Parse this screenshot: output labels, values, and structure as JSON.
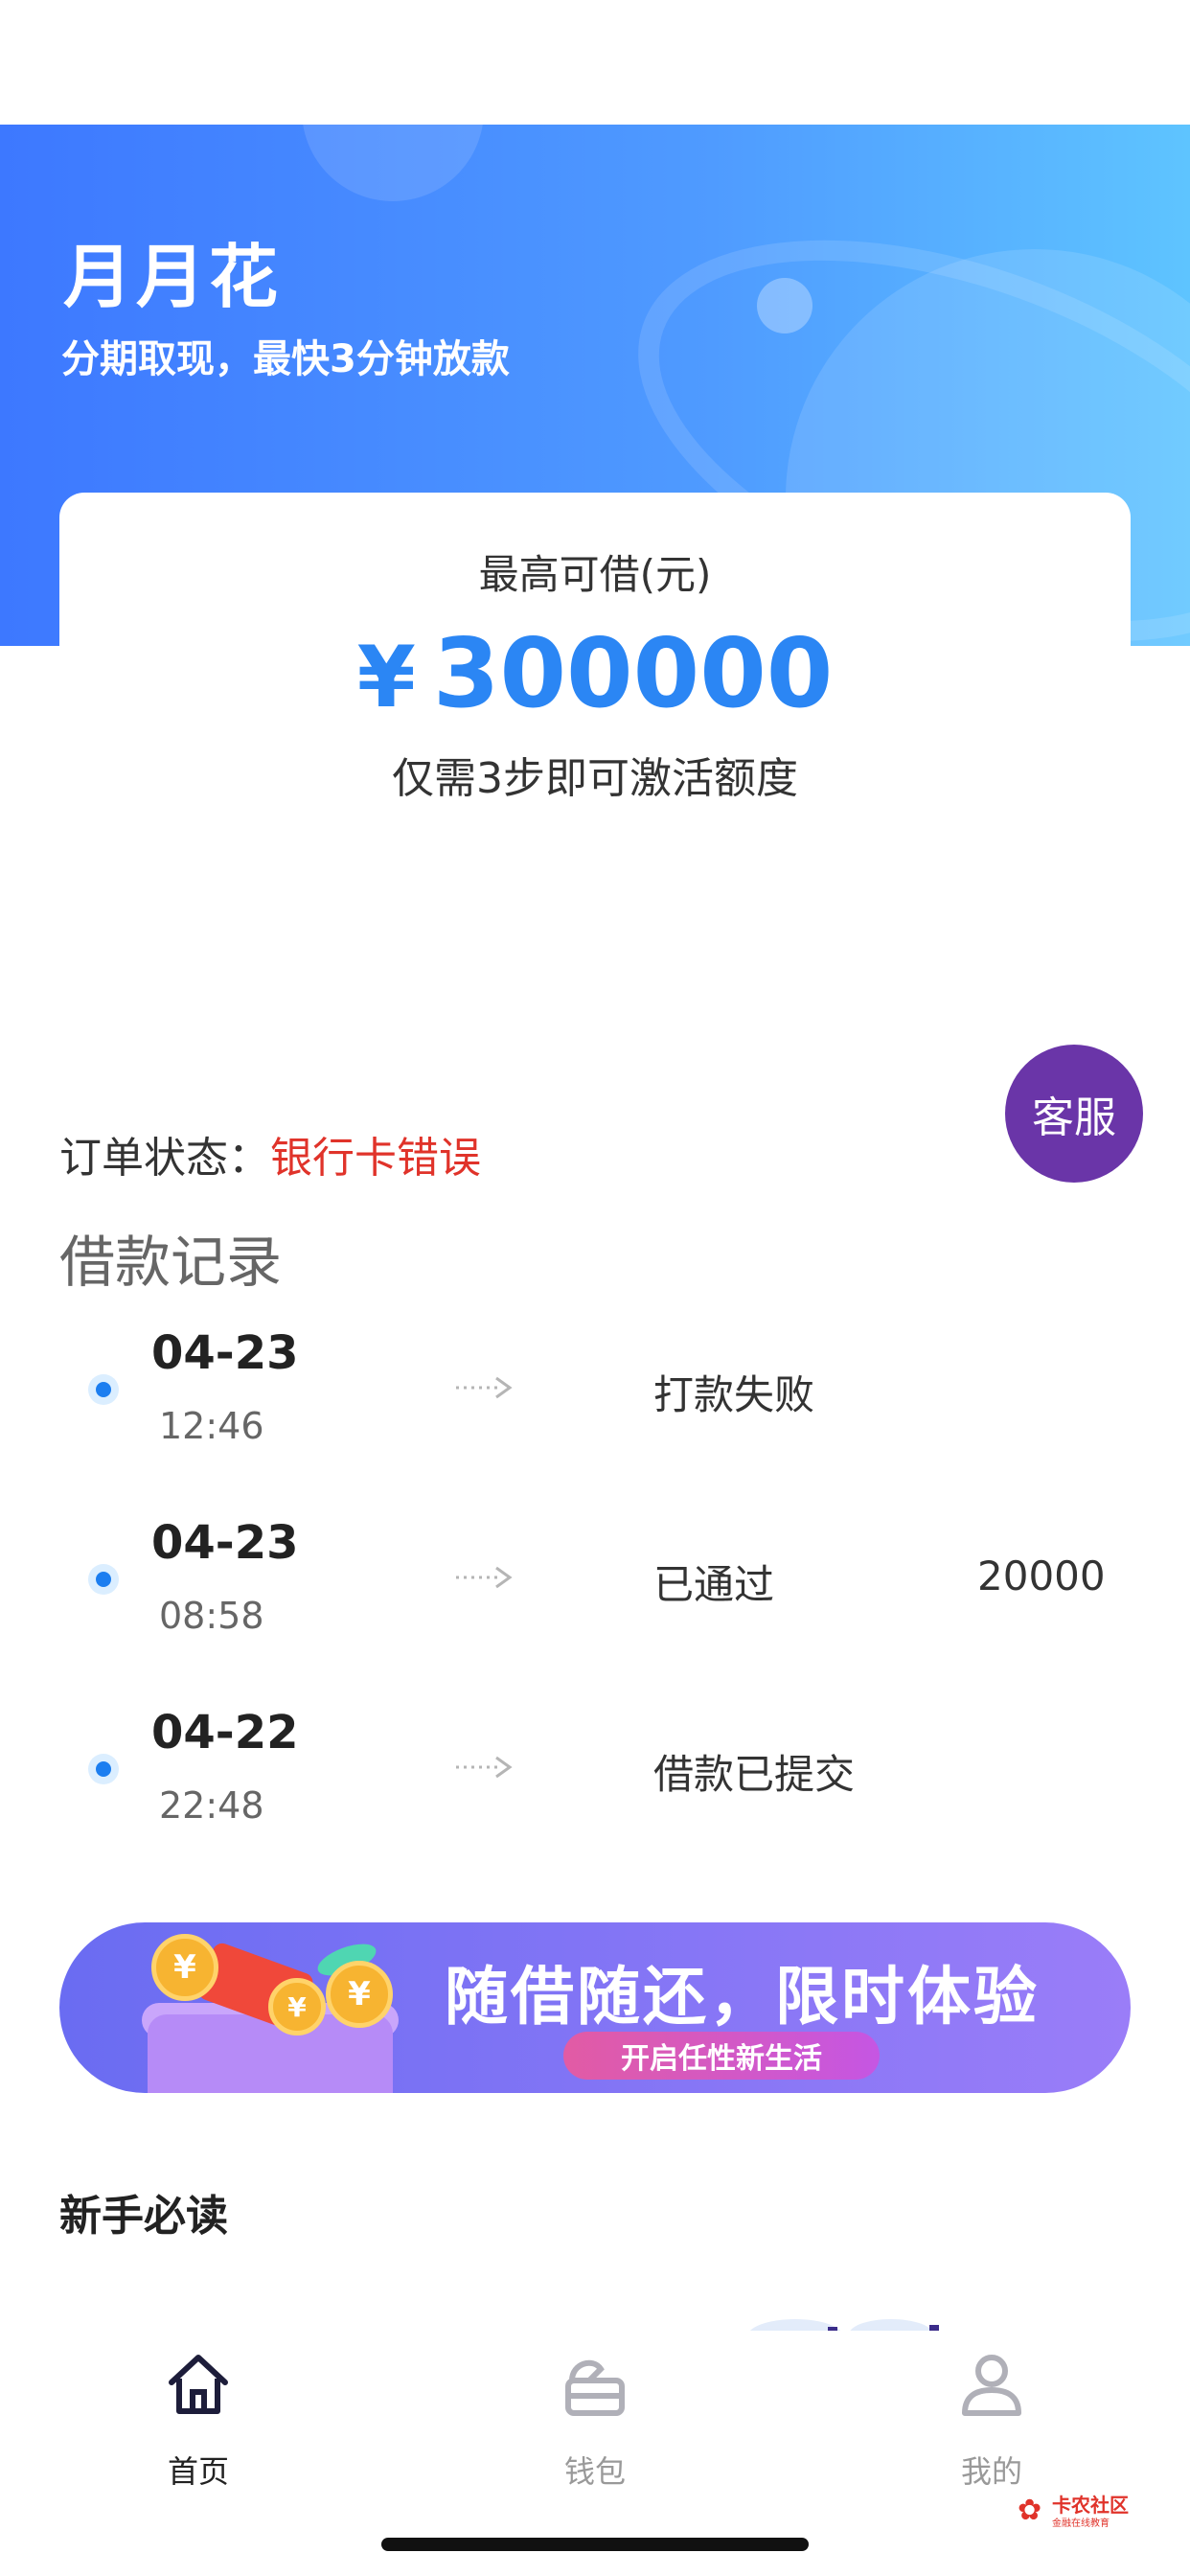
{
  "header": {
    "title": "月月花",
    "subtitle": "分期取现，最快3分钟放款"
  },
  "limit_card": {
    "label": "最高可借(元)",
    "currency": "¥",
    "amount": "300000",
    "note": "仅需3步即可激活额度"
  },
  "customer_service": {
    "label": "客服"
  },
  "order_status": {
    "label": "订单状态：",
    "value": "银行卡错误",
    "value_color": "#e0332a"
  },
  "records": {
    "title": "借款记录",
    "items": [
      {
        "date": "04-23",
        "time": "12:46",
        "status": "打款失败",
        "amount": ""
      },
      {
        "date": "04-23",
        "time": "08:58",
        "status": "已通过",
        "amount": "20000"
      },
      {
        "date": "04-22",
        "time": "22:48",
        "status": "借款已提交",
        "amount": ""
      }
    ]
  },
  "banner": {
    "headline": "随借随还，限时体验",
    "pill": "开启任性新生活",
    "coin_glyph": "¥"
  },
  "newbie_section": {
    "title": "新手必读"
  },
  "tabbar": {
    "items": [
      {
        "label": "首页",
        "icon": "home-icon",
        "active": true
      },
      {
        "label": "钱包",
        "icon": "wallet-icon",
        "active": false
      },
      {
        "label": "我的",
        "icon": "user-icon",
        "active": false
      }
    ]
  },
  "watermark": {
    "text": "卡农社区",
    "sub": "金融在线教育"
  },
  "colors": {
    "brand_blue": "#2b86f4",
    "error_red": "#e0332a",
    "service_purple": "#6a35a8"
  }
}
